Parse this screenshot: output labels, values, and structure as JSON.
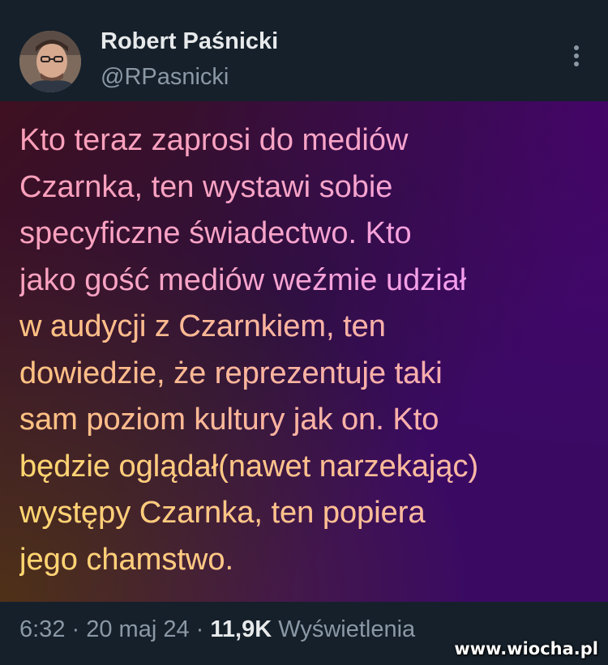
{
  "author": {
    "name": "Robert Paśnicki",
    "handle": "@RPasnicki",
    "avatar_icon": "profile-photo"
  },
  "more_menu_icon": "vertical-dots-icon",
  "tweet": {
    "lines": [
      "Kto teraz zaprosi do mediów",
      "Czarnka, ten wystawi sobie",
      "specyficzne świadectwo. Kto",
      "jako gość mediów weźmie udział",
      "w audycji z Czarnkiem, ten",
      "dowiedzie, że reprezentuje taki",
      "sam poziom kultury jak on. Kto",
      "będzie oglądał(nawet narzekając)",
      "występy Czarnka, ten popiera",
      "jego chamstwo."
    ],
    "colors": {
      "background": "#15202b",
      "gradient_start": "#3e1020",
      "gradient_end": "#3a0a63"
    }
  },
  "meta": {
    "time": "6:32",
    "separator1": " · ",
    "date": "20 maj 24",
    "separator2": " · ",
    "views_count": "11,9K",
    "views_label": " Wyświetlenia"
  },
  "watermark": "www.wiocha.pl"
}
